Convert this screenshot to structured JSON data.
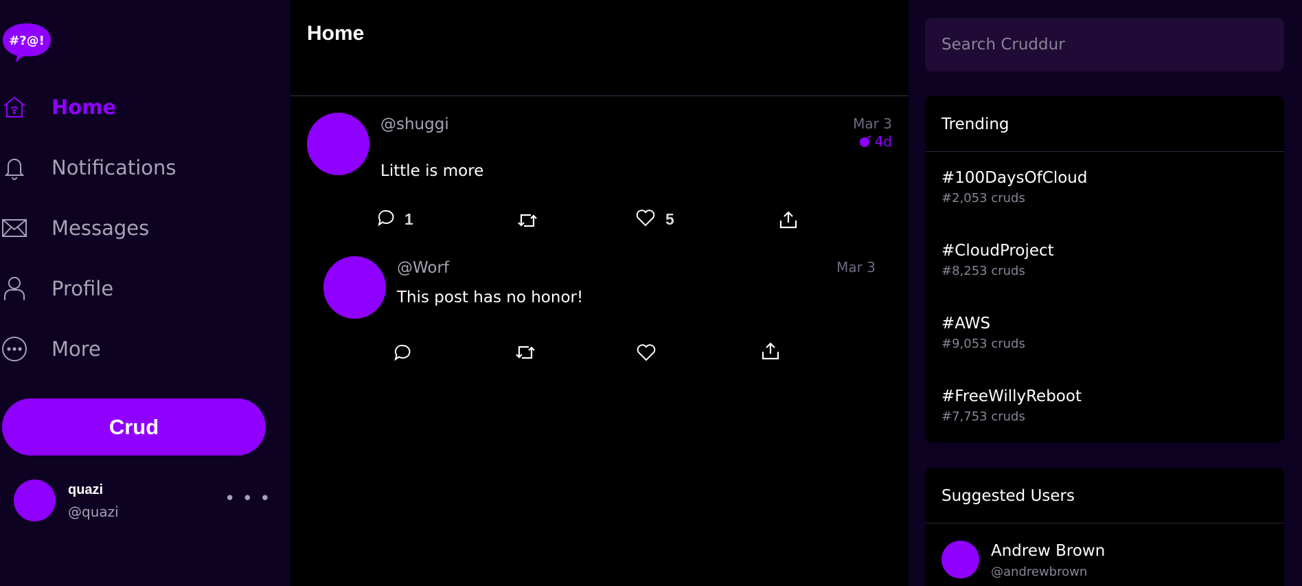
{
  "app": {
    "logo_text": "#?@!",
    "accent": "#9000ff"
  },
  "nav": {
    "items": [
      {
        "label": "Home",
        "icon": "home-icon",
        "active": true
      },
      {
        "label": "Notifications",
        "icon": "bell-icon"
      },
      {
        "label": "Messages",
        "icon": "envelope-icon"
      },
      {
        "label": "Profile",
        "icon": "user-icon"
      },
      {
        "label": "More",
        "icon": "more-circle-icon"
      }
    ],
    "crud_button": "Crud",
    "user": {
      "name": "quazi",
      "handle": "@quazi"
    }
  },
  "main": {
    "title": "Home",
    "posts": [
      {
        "handle": "@shuggi",
        "date": "Mar 3",
        "ttl": "4d",
        "text": "Little is more",
        "replies": "1",
        "likes": "5"
      },
      {
        "handle": "@Worf",
        "date": "Mar 3",
        "text": "This post has no honor!"
      }
    ]
  },
  "search": {
    "placeholder": "Search Cruddur"
  },
  "trending": {
    "title": "Trending",
    "items": [
      {
        "tag": "#100DaysOfCloud",
        "count": "#2,053 cruds"
      },
      {
        "tag": "#CloudProject",
        "count": "#8,253 cruds"
      },
      {
        "tag": "#AWS",
        "count": "#9,053 cruds"
      },
      {
        "tag": "#FreeWillyReboot",
        "count": "#7,753 cruds"
      }
    ]
  },
  "suggested": {
    "title": "Suggested Users",
    "users": [
      {
        "name": "Andrew Brown",
        "handle": "@andrewbrown"
      }
    ]
  }
}
